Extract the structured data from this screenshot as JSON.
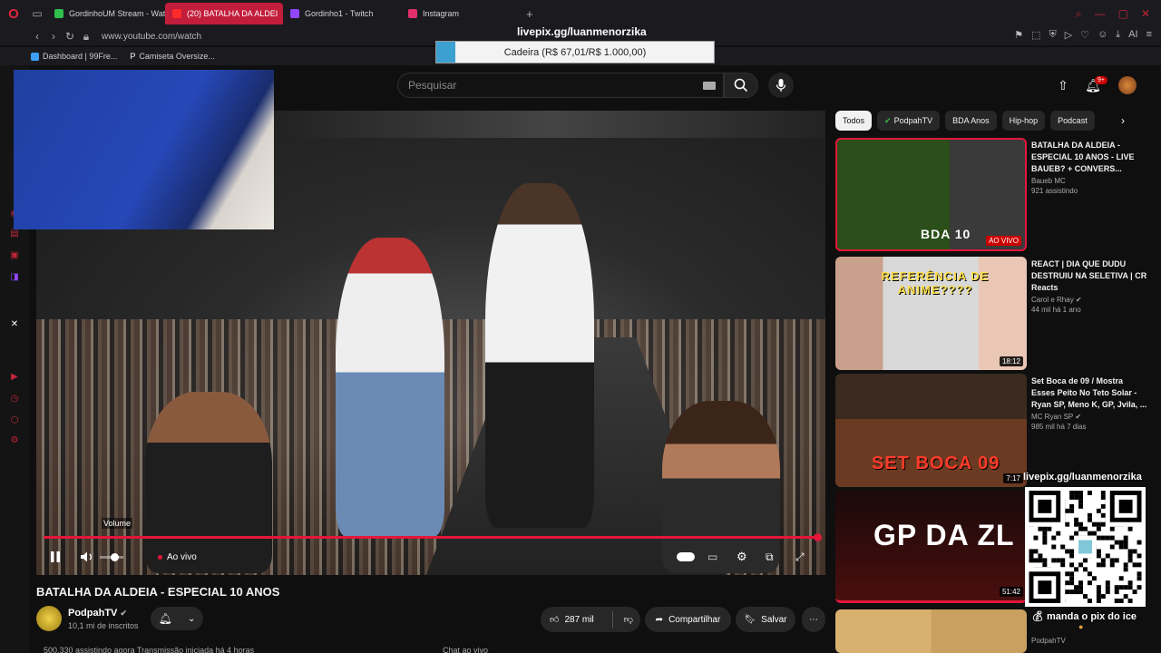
{
  "browser": {
    "tabs": [
      {
        "label": "GordinhoUM Stream - Wat",
        "color": "#2fbf4f",
        "active": false
      },
      {
        "label": "(20) BATALHA DA ALDEI",
        "color": "#ff2a2a",
        "active": true
      },
      {
        "label": "Gordinho1 - Twitch",
        "color": "#9146ff",
        "active": false
      },
      {
        "label": "Instagram",
        "color": "#e1306c",
        "active": false
      }
    ],
    "url": "www.youtube.com/watch",
    "bookmarks": [
      "Dashboard | 99Fre...",
      "Camiseta Oversize..."
    ],
    "ai_label": "AI"
  },
  "overlay": {
    "pix_url": "livepix.gg/luanmenorzika",
    "goal_text": "Cadeira (R$ 67,01/R$ 1.000,00)",
    "goal_progress": 0.067,
    "qr_caption": "manda o pix do ice"
  },
  "youtube": {
    "search_placeholder": "Pesquisar",
    "notification_count": "9+"
  },
  "player": {
    "volume_tooltip": "Volume",
    "live_label": "Ao vivo",
    "progress": 1.0
  },
  "video": {
    "title": "BATALHA DA ALDEIA - ESPECIAL 10 ANOS",
    "channel": "PodpahTV",
    "subscribers": "10,1 mi de inscritos",
    "likes": "287 mil",
    "share_label": "Compartilhar",
    "save_label": "Salvar",
    "below_left": "500.330 assistindo agora  Transmissão iniciada há 4 horas",
    "below_chat": "Chat ao vivo"
  },
  "chips": [
    "Todos",
    "PodpahTV",
    "BDA Anos",
    "Hip-hop",
    "Podcast"
  ],
  "recommendations": [
    {
      "title": "BATALHA DA ALDEIA - ESPECIAL 10 ANOS - LIVE BAUEB? + CONVERS...",
      "channel": "Baueb MC",
      "stats": "921 assistindo",
      "badge": "AO VIVO",
      "thumb_text": "BDA 10"
    },
    {
      "title": "REACT | DIA QUE DUDU DESTRUIU NA SELETIVA | CR Reacts",
      "channel": "Carol e Rhay",
      "stats": "44 mil  há 1 ano",
      "badge": "18:12",
      "thumb_text": "REFERÊNCIA DE ANIME????"
    },
    {
      "title": "Set Boca de 09 / Mostra Esses Peito No Teto Solar - Ryan SP, Meno K, GP, Jvila, ...",
      "channel": "MC Ryan SP",
      "stats": "985 mil  há 7 dias",
      "badge": "7:17",
      "thumb_text": "SET BOCA 09"
    },
    {
      "title": "",
      "channel": "",
      "stats": "",
      "badge": "51:42",
      "thumb_text": "GP DA ZL"
    }
  ],
  "bottom_channel": "PodpahTV"
}
